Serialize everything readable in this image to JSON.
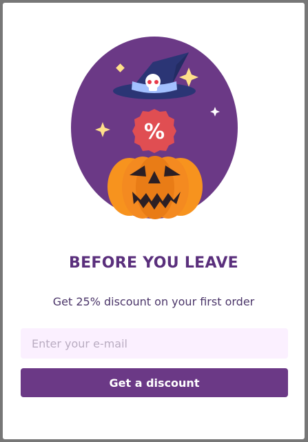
{
  "popup": {
    "illustration": "halloween-pumpkin-witch-hat-discount",
    "discount_badge_text": "%",
    "title": "BEFORE YOU LEAVE",
    "subtitle": "Get 25% discount on your first order",
    "email_placeholder": "Enter your e-mail",
    "email_value": "",
    "button_label": "Get a discount"
  },
  "colors": {
    "overlay": "#777777",
    "circle": "#6b3986",
    "title": "#5a2f7c",
    "input_bg": "#fbf0ff",
    "button_bg": "#6b3986",
    "pumpkin": "#f48a20",
    "badge": "#e04e52",
    "sparkle": "#ffe08a"
  }
}
